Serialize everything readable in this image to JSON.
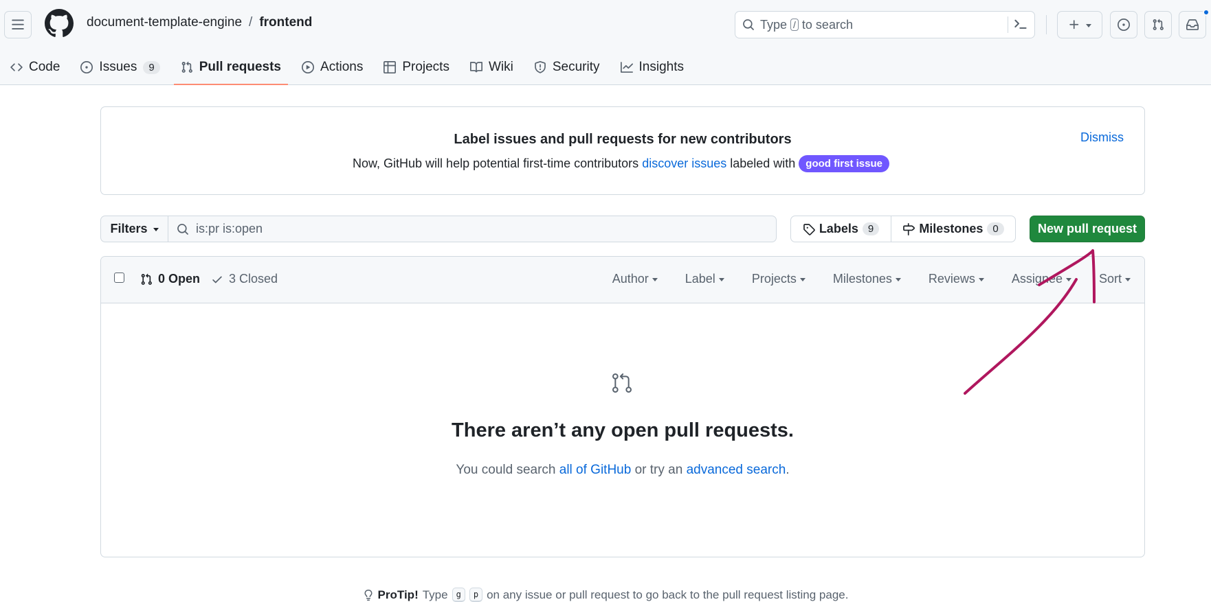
{
  "header": {
    "owner": "document-template-engine",
    "separator": "/",
    "repo": "frontend",
    "search_prefix": "Type",
    "search_key": "/",
    "search_suffix": "to search"
  },
  "nav": {
    "items": [
      {
        "label": "Code",
        "icon": "code-icon"
      },
      {
        "label": "Issues",
        "icon": "issue-opened-icon",
        "count": "9"
      },
      {
        "label": "Pull requests",
        "icon": "git-pull-request-icon",
        "selected": true
      },
      {
        "label": "Actions",
        "icon": "play-icon"
      },
      {
        "label": "Projects",
        "icon": "table-icon"
      },
      {
        "label": "Wiki",
        "icon": "book-icon"
      },
      {
        "label": "Security",
        "icon": "shield-icon"
      },
      {
        "label": "Insights",
        "icon": "graph-icon"
      }
    ]
  },
  "banner": {
    "title": "Label issues and pull requests for new contributors",
    "text_before": "Now, GitHub will help potential first-time contributors",
    "link": "discover issues",
    "text_after": "labeled with",
    "pill": "good first issue",
    "pill_color": "#7057ff",
    "dismiss": "Dismiss"
  },
  "filters": {
    "button": "Filters",
    "query": "is:pr is:open",
    "labels_label": "Labels",
    "labels_count": "9",
    "milestones_label": "Milestones",
    "milestones_count": "0",
    "new_pr": "New pull request"
  },
  "list": {
    "open": "0 Open",
    "closed": "3 Closed",
    "menus": [
      "Author",
      "Label",
      "Projects",
      "Milestones",
      "Reviews",
      "Assignee",
      "Sort"
    ]
  },
  "blank": {
    "title": "There aren’t any open pull requests.",
    "text_before": "You could search",
    "link1": "all of GitHub",
    "text_middle": "or try an",
    "link2": "advanced search",
    "text_after": "."
  },
  "protip": {
    "label": "ProTip!",
    "text_before": "Type",
    "key1": "g",
    "key2": "p",
    "text_after": "on any issue or pull request to go back to the pull request listing page."
  },
  "colors": {
    "accent": "#0969da",
    "primary_button": "#1f883d",
    "annotation": "#b0175e"
  }
}
